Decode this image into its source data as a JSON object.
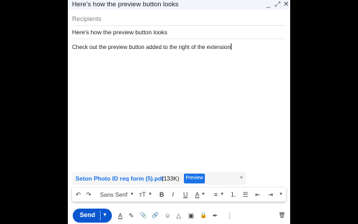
{
  "compose": {
    "title": "Here's how the preview button looks",
    "recipients_placeholder": "Recipients",
    "subject": "Here's how the preview button looks",
    "body": "Check out the preview button added to the right of the extension"
  },
  "window_controls": {
    "minimize": "_",
    "expand": "⤢",
    "close": "✕"
  },
  "attachment": {
    "name": "Seton Photo ID req form (5).pdf",
    "size": "(133K)",
    "preview_label": "Preview",
    "remove": "×"
  },
  "format_toolbar": {
    "undo": "↶",
    "redo": "↷",
    "font": "Sans Serif",
    "font_caret": "▾",
    "size": "тT",
    "size_caret": "▾",
    "bold": "B",
    "italic": "I",
    "underline": "U",
    "text_color": "A",
    "text_color_caret": "▾",
    "align": "≡",
    "align_caret": "▾",
    "numbered_list": "⒈",
    "bulleted_list": "☰",
    "indent_less": "⇤",
    "indent_more": "⇥",
    "more": "▾"
  },
  "bottom_bar": {
    "send_label": "Send",
    "send_more": "▾",
    "formatting": "A",
    "ai_write": "✎",
    "attach_file": "📎",
    "link": "🔗",
    "emoji": "☺",
    "drive": "△",
    "photo": "▣",
    "confidential": "🔒",
    "signature": "✒",
    "more": "⋮",
    "discard": "🗑"
  },
  "colors": {
    "accent": "#1a73e8",
    "send": "#0b57d0",
    "titlebar": "#f2f6fc"
  }
}
